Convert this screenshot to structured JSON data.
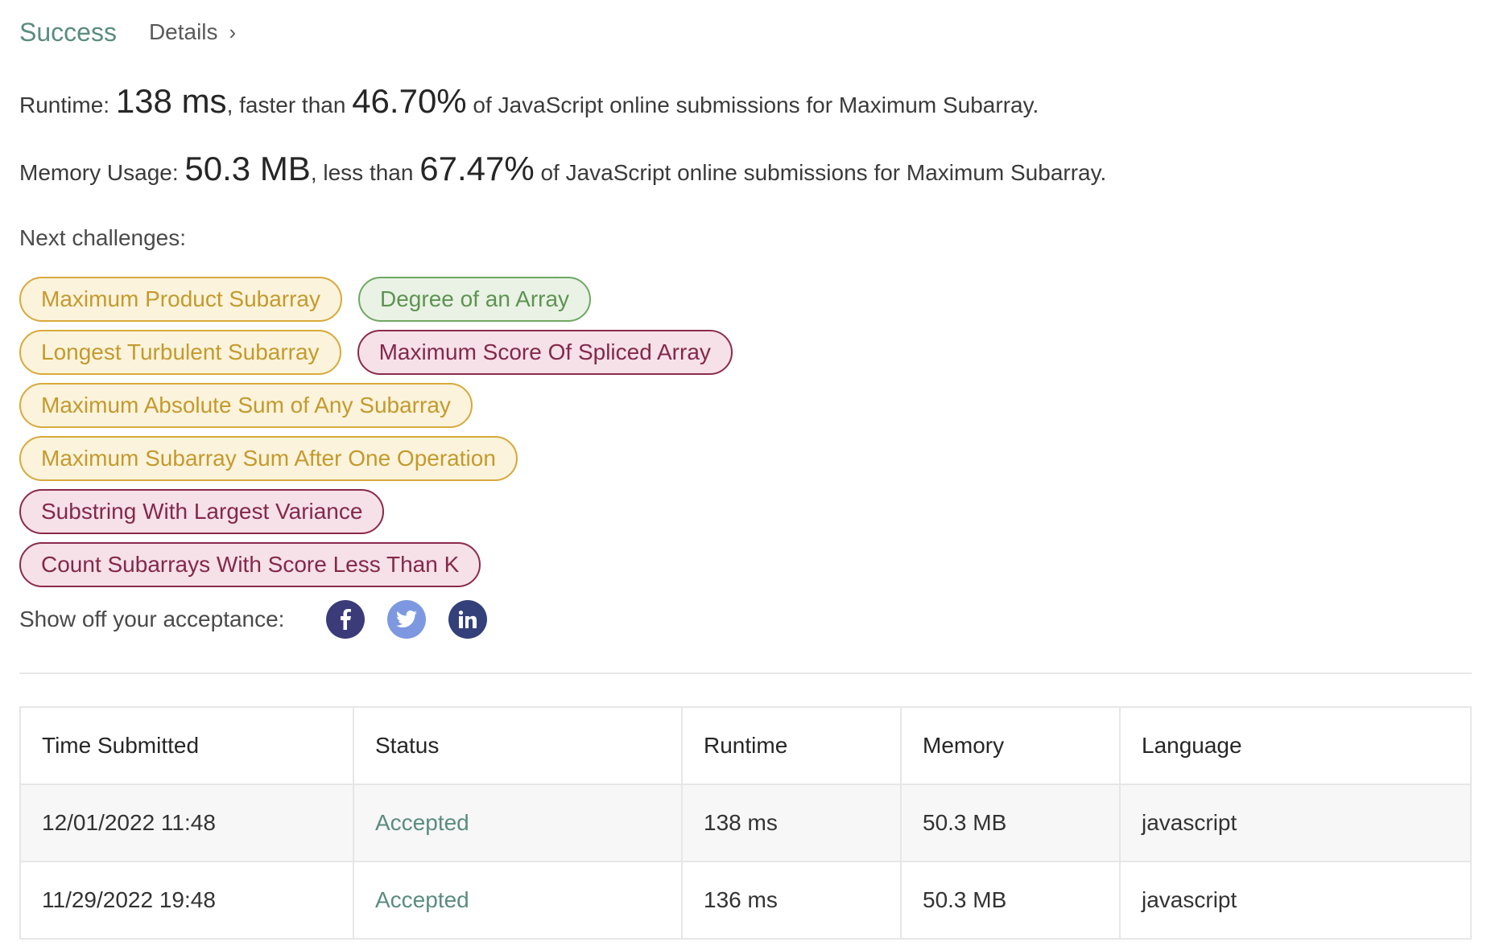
{
  "header": {
    "status": "Success",
    "details_label": "Details"
  },
  "runtime": {
    "prefix": "Runtime: ",
    "value": "138 ms",
    "middle": ", faster than ",
    "percent": "46.70%",
    "suffix": " of JavaScript online submissions for Maximum Subarray."
  },
  "memory": {
    "prefix": "Memory Usage: ",
    "value": "50.3 MB",
    "middle": ", less than ",
    "percent": "67.47%",
    "suffix": " of JavaScript online submissions for Maximum Subarray."
  },
  "next_challenges": {
    "label": "Next challenges:",
    "items": [
      {
        "label": "Maximum Product Subarray",
        "difficulty": "medium"
      },
      {
        "label": "Degree of an Array",
        "difficulty": "easy"
      },
      {
        "label": "Longest Turbulent Subarray",
        "difficulty": "medium"
      },
      {
        "label": "Maximum Score Of Spliced Array",
        "difficulty": "hard"
      },
      {
        "label": "Maximum Absolute Sum of Any Subarray",
        "difficulty": "medium"
      },
      {
        "label": "Maximum Subarray Sum After One Operation",
        "difficulty": "medium"
      },
      {
        "label": "Substring With Largest Variance",
        "difficulty": "hard"
      },
      {
        "label": "Count Subarrays With Score Less Than K",
        "difficulty": "hard"
      }
    ]
  },
  "share": {
    "label": "Show off your acceptance:",
    "icons": [
      "facebook-icon",
      "twitter-icon",
      "linkedin-icon"
    ]
  },
  "table": {
    "headers": [
      "Time Submitted",
      "Status",
      "Runtime",
      "Memory",
      "Language"
    ],
    "rows": [
      [
        "12/01/2022 11:48",
        "Accepted",
        "138 ms",
        "50.3 MB",
        "javascript"
      ],
      [
        "11/29/2022 19:48",
        "Accepted",
        "136 ms",
        "50.3 MB",
        "javascript"
      ]
    ]
  },
  "colors": {
    "success": "#5a8c7f",
    "medium": "#d9a93b",
    "easy": "#6fa862",
    "hard": "#8b2a4d"
  }
}
